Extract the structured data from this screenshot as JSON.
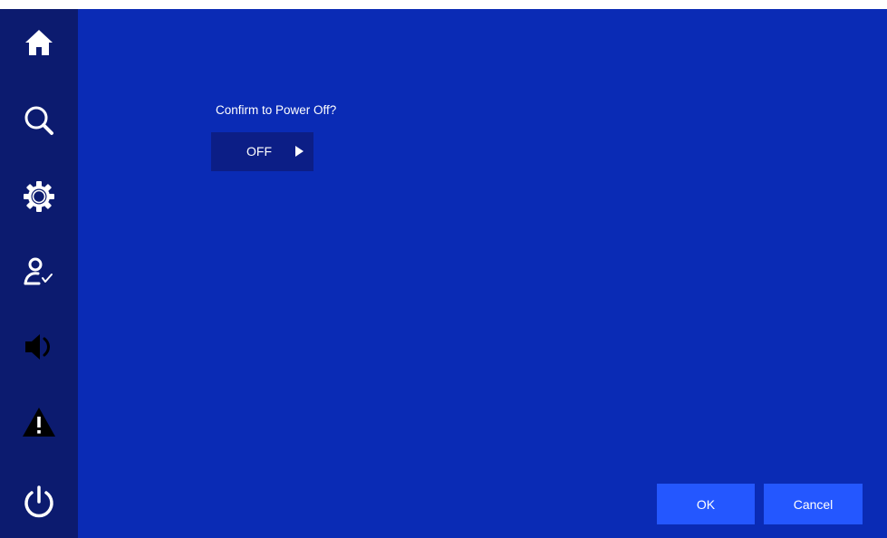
{
  "sidebar": {
    "items": [
      {
        "icon": "home-icon",
        "label": "Home"
      },
      {
        "icon": "search-icon",
        "label": "Search"
      },
      {
        "icon": "gear-icon",
        "label": "Settings"
      },
      {
        "icon": "user-check-icon",
        "label": "User"
      },
      {
        "icon": "speaker-icon",
        "label": "Volume"
      },
      {
        "icon": "warning-icon",
        "label": "Alarm"
      },
      {
        "icon": "power-icon",
        "label": "Power"
      }
    ]
  },
  "dialog": {
    "prompt": "Confirm to Power Off?",
    "select_value": "OFF"
  },
  "buttons": {
    "ok": "OK",
    "cancel": "Cancel"
  },
  "colors": {
    "background": "#0a2bb5",
    "sidebar": "#0c1b6f",
    "select_bg": "#0c1e86",
    "button": "#2457ff",
    "text": "#ffffff"
  }
}
